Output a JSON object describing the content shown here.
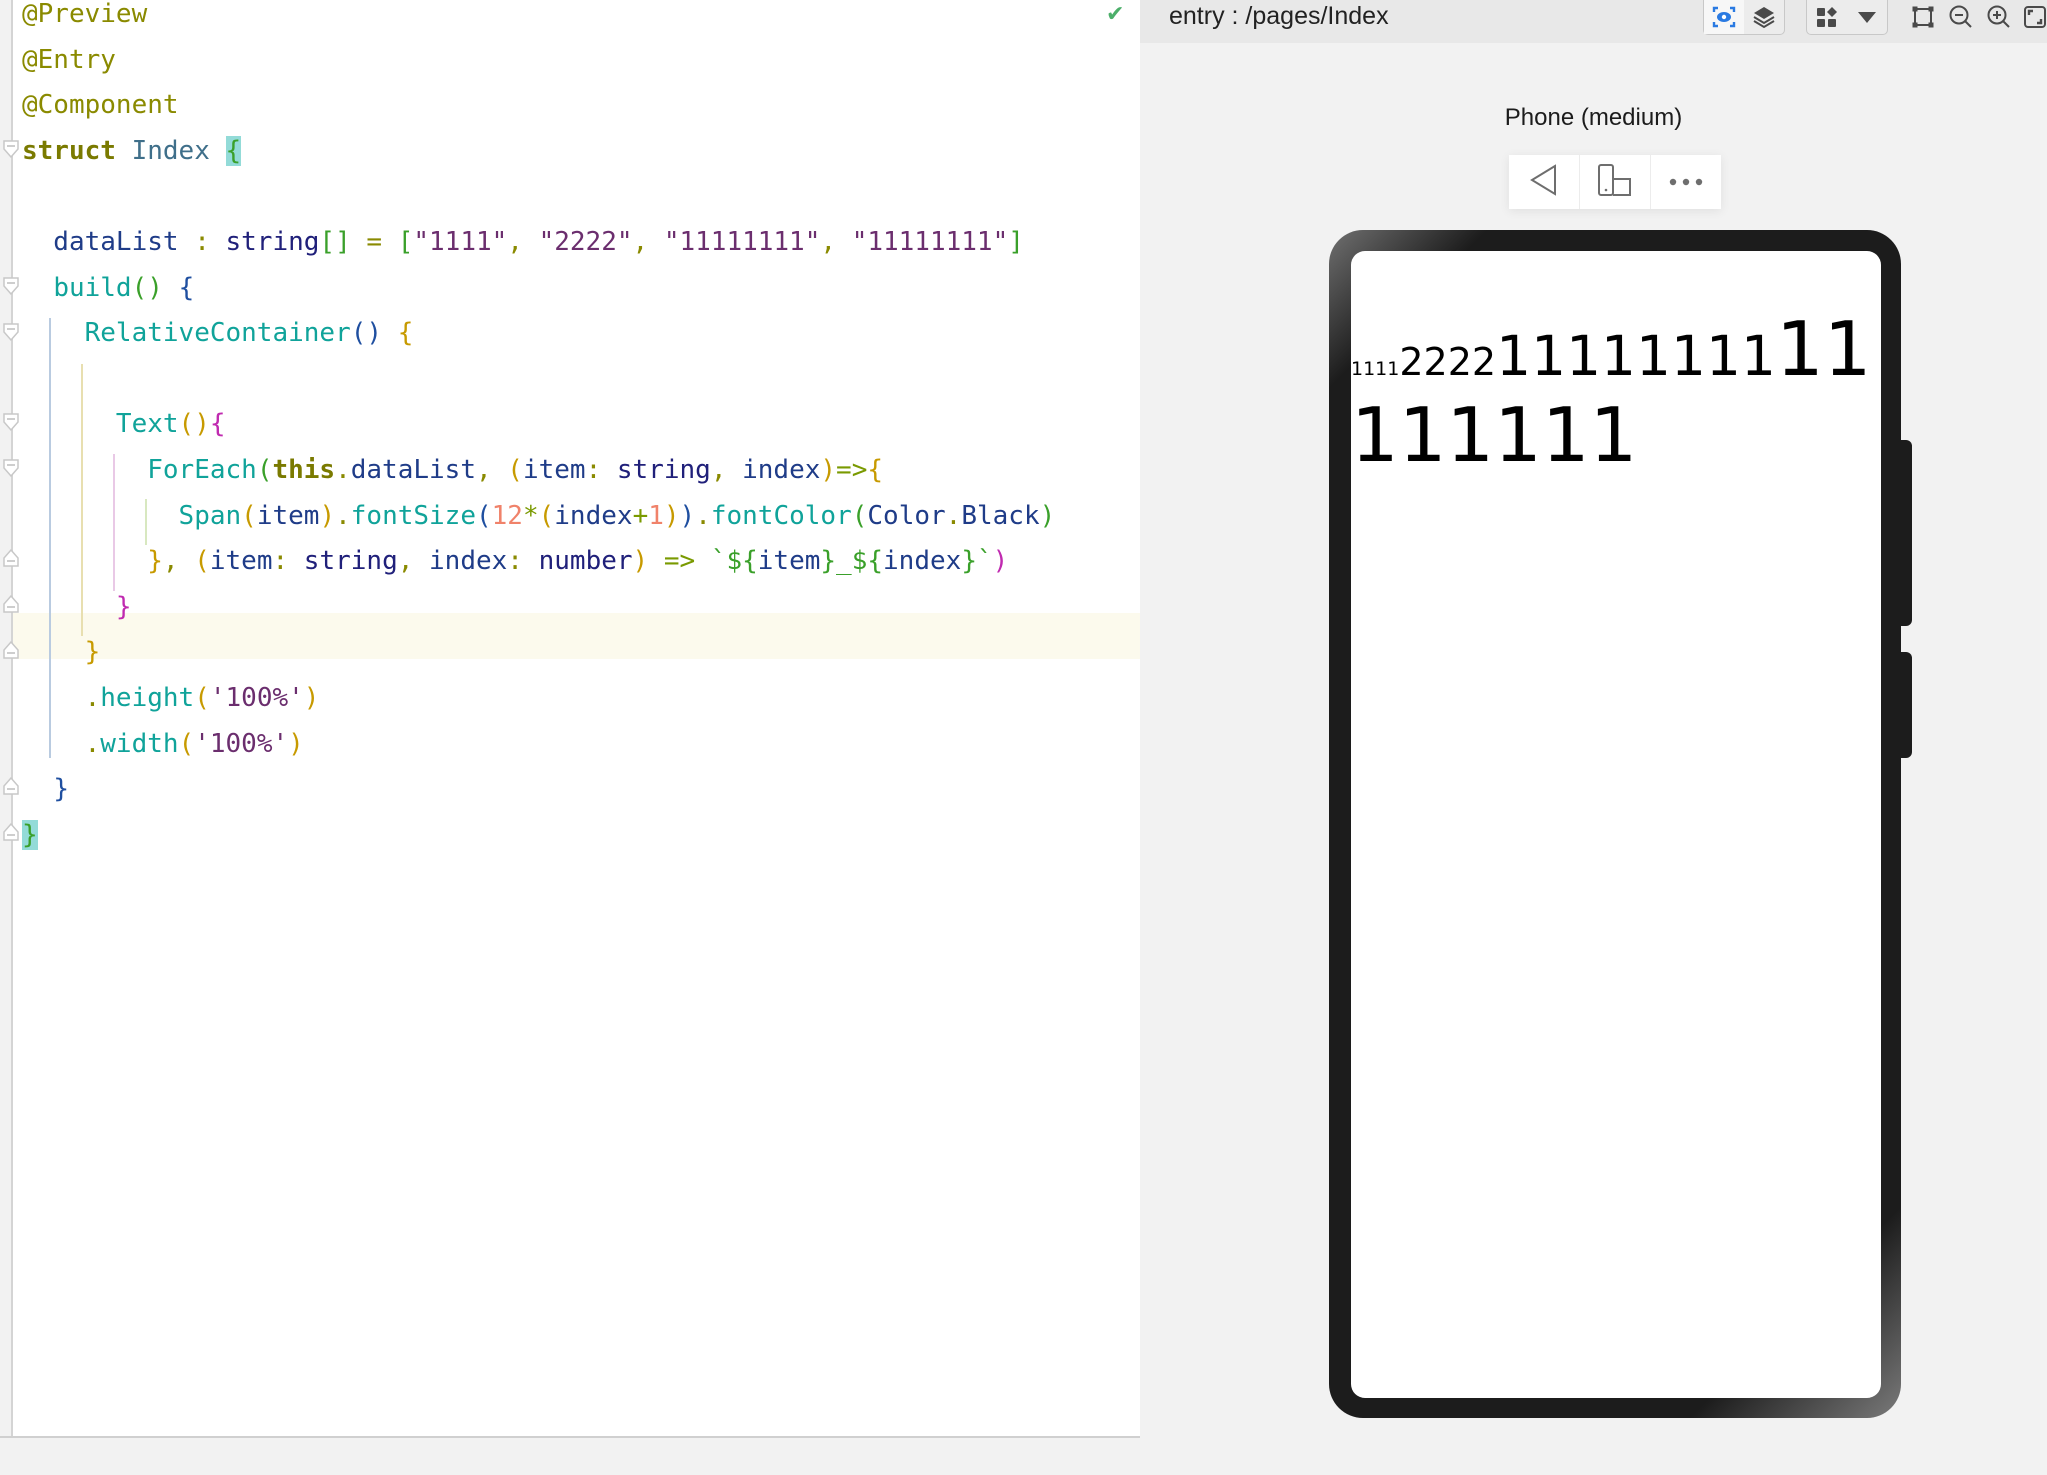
{
  "editor": {
    "status_icon": "check-icon",
    "lines": [
      [
        [
          "t-anno",
          "@Preview"
        ]
      ],
      [
        [
          "t-anno",
          "@Entry"
        ]
      ],
      [
        [
          "t-anno",
          "@Component"
        ]
      ],
      [
        [
          "t-kw",
          "struct"
        ],
        [
          "t-plain",
          " "
        ],
        [
          "t-cls",
          "Index"
        ],
        [
          "t-plain",
          " "
        ],
        [
          "t-p4 match-brace",
          "{"
        ]
      ],
      [],
      [
        [
          "t-plain",
          "  dataList "
        ],
        [
          "t-punc",
          ":"
        ],
        [
          "t-plain",
          " "
        ],
        [
          "t-type",
          "string"
        ],
        [
          "t-p4",
          "[]"
        ],
        [
          "t-plain",
          " "
        ],
        [
          "t-punc",
          "="
        ],
        [
          "t-plain",
          " "
        ],
        [
          "t-p4",
          "["
        ],
        [
          "t-str",
          "\"1111\""
        ],
        [
          "t-punc",
          ","
        ],
        [
          "t-plain",
          " "
        ],
        [
          "t-str",
          "\"2222\""
        ],
        [
          "t-punc",
          ","
        ],
        [
          "t-plain",
          " "
        ],
        [
          "t-str",
          "\"11111111\""
        ],
        [
          "t-punc",
          ","
        ],
        [
          "t-plain",
          " "
        ],
        [
          "t-str",
          "\"11111111\""
        ],
        [
          "t-p4",
          "]"
        ]
      ],
      [
        [
          "t-plain",
          "  "
        ],
        [
          "t-fn",
          "build"
        ],
        [
          "t-p4",
          "()"
        ],
        [
          "t-plain",
          " "
        ],
        [
          "t-p3",
          "{"
        ]
      ],
      [
        [
          "t-plain",
          "    "
        ],
        [
          "t-fn",
          "RelativeContainer"
        ],
        [
          "t-p3",
          "()"
        ],
        [
          "t-plain",
          " "
        ],
        [
          "t-p1",
          "{"
        ]
      ],
      [],
      [
        [
          "t-plain",
          "      "
        ],
        [
          "t-fn",
          "Text"
        ],
        [
          "t-p1",
          "()"
        ],
        [
          "t-p2",
          "{"
        ]
      ],
      [
        [
          "t-plain",
          "        "
        ],
        [
          "t-fn",
          "ForEach"
        ],
        [
          "t-p4",
          "("
        ],
        [
          "t-kw",
          "this"
        ],
        [
          "t-punc",
          "."
        ],
        [
          "t-plain",
          "dataList"
        ],
        [
          "t-punc",
          ","
        ],
        [
          "t-plain",
          " "
        ],
        [
          "t-p1",
          "("
        ],
        [
          "t-plain",
          "item"
        ],
        [
          "t-punc",
          ":"
        ],
        [
          "t-plain",
          " "
        ],
        [
          "t-type",
          "string"
        ],
        [
          "t-punc",
          ","
        ],
        [
          "t-plain",
          " index"
        ],
        [
          "t-p1",
          ")"
        ],
        [
          "t-op",
          "=>"
        ],
        [
          "t-p1",
          "{"
        ]
      ],
      [
        [
          "t-plain",
          "          "
        ],
        [
          "t-fn",
          "Span"
        ],
        [
          "t-p1",
          "("
        ],
        [
          "t-plain",
          "item"
        ],
        [
          "t-p1",
          ")"
        ],
        [
          "t-punc",
          "."
        ],
        [
          "t-fn",
          "fontSize"
        ],
        [
          "t-p3",
          "("
        ],
        [
          "t-num",
          "12"
        ],
        [
          "t-op",
          "*"
        ],
        [
          "t-p1",
          "("
        ],
        [
          "t-plain",
          "index"
        ],
        [
          "t-op",
          "+"
        ],
        [
          "t-num",
          "1"
        ],
        [
          "t-p1",
          ")"
        ],
        [
          "t-p3",
          ")"
        ],
        [
          "t-punc",
          "."
        ],
        [
          "t-fn",
          "fontColor"
        ],
        [
          "t-p4",
          "("
        ],
        [
          "t-plain",
          "Color"
        ],
        [
          "t-punc",
          "."
        ],
        [
          "t-plain",
          "Black"
        ],
        [
          "t-p4",
          ")"
        ]
      ],
      [
        [
          "t-plain",
          "        "
        ],
        [
          "t-p1",
          "}"
        ],
        [
          "t-punc",
          ","
        ],
        [
          "t-plain",
          " "
        ],
        [
          "t-p1",
          "("
        ],
        [
          "t-plain",
          "item"
        ],
        [
          "t-punc",
          ":"
        ],
        [
          "t-plain",
          " "
        ],
        [
          "t-type",
          "string"
        ],
        [
          "t-punc",
          ","
        ],
        [
          "t-plain",
          " index"
        ],
        [
          "t-punc",
          ":"
        ],
        [
          "t-plain",
          " "
        ],
        [
          "t-type",
          "number"
        ],
        [
          "t-p1",
          ")"
        ],
        [
          "t-plain",
          " "
        ],
        [
          "t-op",
          "=>"
        ],
        [
          "t-plain",
          " "
        ],
        [
          "t-p4",
          "`${"
        ],
        [
          "t-plain",
          "item"
        ],
        [
          "t-p4",
          "}_${"
        ],
        [
          "t-plain",
          "index"
        ],
        [
          "t-p4",
          "}`"
        ],
        [
          "t-p2",
          ")"
        ]
      ],
      [
        [
          "t-plain",
          "      "
        ],
        [
          "t-p2",
          "}"
        ]
      ],
      [
        [
          "t-plain",
          "    "
        ],
        [
          "t-p1",
          "}"
        ]
      ],
      [
        [
          "t-plain",
          "    "
        ],
        [
          "t-punc",
          "."
        ],
        [
          "t-fn",
          "height"
        ],
        [
          "t-p1",
          "("
        ],
        [
          "t-str",
          "'100%'"
        ],
        [
          "t-p1",
          ")"
        ]
      ],
      [
        [
          "t-plain",
          "    "
        ],
        [
          "t-punc",
          "."
        ],
        [
          "t-fn",
          "width"
        ],
        [
          "t-p1",
          "("
        ],
        [
          "t-str",
          "'100%'"
        ],
        [
          "t-p1",
          ")"
        ]
      ],
      [
        [
          "t-plain",
          "  "
        ],
        [
          "t-p3",
          "}"
        ]
      ],
      [
        [
          "t-p4 match-brace",
          "}"
        ]
      ]
    ]
  },
  "preview": {
    "route_label": "entry : /pages/Index",
    "toolbar": {
      "inspect_icon": "eye-inspect-icon",
      "layers_icon": "layers-icon",
      "components_icon": "components-icon",
      "dropdown_icon": "caret-down-icon",
      "bounds_icon": "bounds-frame-icon",
      "zoom_out_icon": "zoom-out-icon",
      "zoom_in_icon": "zoom-in-icon",
      "fit_icon": "fit-screen-icon"
    },
    "device_name": "Phone (medium)",
    "device_bar": {
      "back_icon": "back-triangle-icon",
      "rotate_icon": "rotate-device-icon",
      "more_icon": "more-dots-icon"
    },
    "screen_spans": [
      "1111",
      "2222",
      "11111111",
      "11111111"
    ]
  }
}
